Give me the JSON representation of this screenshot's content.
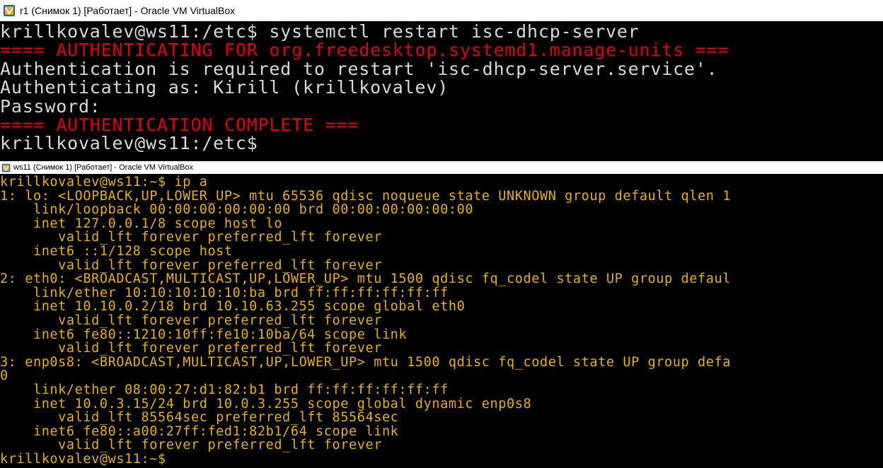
{
  "windows": [
    {
      "title": "r1 (Снимок 1) [Работает] - Oracle VM VirtualBox",
      "icon": "virtualbox-icon",
      "lines": [
        {
          "text": "krillkovalev@ws11:/etc$ systemctl restart isc-dhcp-server",
          "color": "white"
        },
        {
          "text": "==== AUTHENTICATING FOR org.freedesktop.systemd1.manage-units ===",
          "color": "red"
        },
        {
          "text": "Authentication is required to restart 'isc-dhcp-server.service'.",
          "color": "white"
        },
        {
          "text": "Authenticating as: Kirill (krillkovalev)",
          "color": "white"
        },
        {
          "text": "Password:",
          "color": "white"
        },
        {
          "text": "==== AUTHENTICATION COMPLETE ===",
          "color": "red"
        },
        {
          "text": "krillkovalev@ws11:/etc$",
          "color": "white"
        }
      ]
    },
    {
      "title": "ws11 (Снимок 1) [Работает] - Oracle VM VirtualBox",
      "icon": "virtualbox-icon",
      "lines": [
        {
          "text": "krillkovalev@ws11:~$ ip a",
          "color": "amber"
        },
        {
          "text": "1: lo: <LOOPBACK,UP,LOWER_UP> mtu 65536 qdisc noqueue state UNKNOWN group default qlen 1",
          "color": "amber"
        },
        {
          "text": "    link/loopback 00:00:00:00:00:00 brd 00:00:00:00:00:00",
          "color": "amber"
        },
        {
          "text": "    inet 127.0.0.1/8 scope host lo",
          "color": "amber"
        },
        {
          "text": "       valid_lft forever preferred_lft forever",
          "color": "amber"
        },
        {
          "text": "    inet6 ::1/128 scope host",
          "color": "amber"
        },
        {
          "text": "       valid_lft forever preferred_lft forever",
          "color": "amber"
        },
        {
          "text": "2: eth0: <BROADCAST,MULTICAST,UP,LOWER_UP> mtu 1500 qdisc fq_codel state UP group defaul",
          "color": "amber"
        },
        {
          "text": "    link/ether 10:10:10:10:10:ba brd ff:ff:ff:ff:ff:ff",
          "color": "amber"
        },
        {
          "text": "    inet 10.10.0.2/18 brd 10.10.63.255 scope global eth0",
          "color": "amber"
        },
        {
          "text": "       valid_lft forever preferred_lft forever",
          "color": "amber"
        },
        {
          "text": "    inet6 fe80::1210:10ff:fe10:10ba/64 scope link",
          "color": "amber"
        },
        {
          "text": "       valid_lft forever preferred_lft forever",
          "color": "amber"
        },
        {
          "text": "3: enp0s8: <BROADCAST,MULTICAST,UP,LOWER_UP> mtu 1500 qdisc fq_codel state UP group defa",
          "color": "amber"
        },
        {
          "text": "0",
          "color": "amber"
        },
        {
          "text": "    link/ether 08:00:27:d1:82:b1 brd ff:ff:ff:ff:ff:ff",
          "color": "amber"
        },
        {
          "text": "    inet 10.0.3.15/24 brd 10.0.3.255 scope global dynamic enp0s8",
          "color": "amber"
        },
        {
          "text": "       valid_lft 85564sec preferred_lft 85564sec",
          "color": "amber"
        },
        {
          "text": "    inet6 fe80::a00:27ff:fed1:82b1/64 scope link",
          "color": "amber"
        },
        {
          "text": "       valid_lft forever preferred_lft forever",
          "color": "amber"
        },
        {
          "text": "krillkovalev@ws11:~$",
          "color": "amber"
        }
      ]
    }
  ],
  "colors": {
    "white": "#d8d8d8",
    "red": "#e00000",
    "amber": "#e8b000",
    "console_bg": "#000000",
    "titlebar_bg": "#ffffff"
  }
}
